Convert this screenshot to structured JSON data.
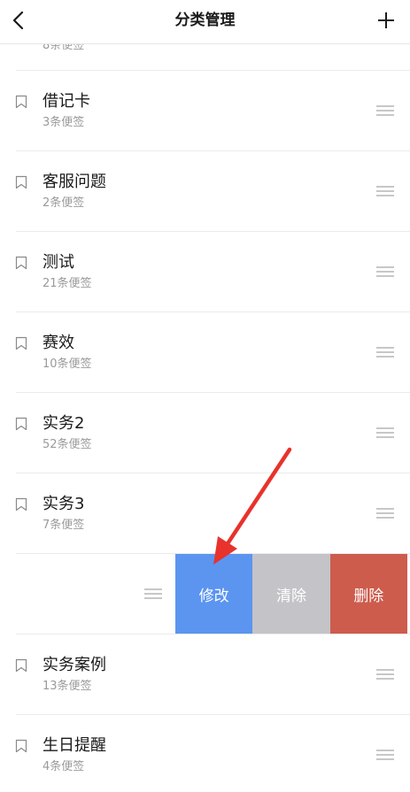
{
  "header": {
    "title": "分类管理",
    "back_icon": "chevron-left-icon",
    "add_icon": "plus-icon"
  },
  "peek_item": {
    "count": "8条便签"
  },
  "items": [
    {
      "name": "借记卡",
      "count": "3条便签"
    },
    {
      "name": "客服问题",
      "count": "2条便签"
    },
    {
      "name": "测试",
      "count": "21条便签"
    },
    {
      "name": "赛效",
      "count": "10条便签"
    },
    {
      "name": "实务2",
      "count": "52条便签"
    },
    {
      "name": "实务3",
      "count": "7条便签"
    }
  ],
  "swipe_actions": {
    "edit_label": "修改",
    "clear_label": "清除",
    "delete_label": "删除"
  },
  "items_after": [
    {
      "name": "实务案例",
      "count": "13条便签"
    },
    {
      "name": "生日提醒",
      "count": "4条便签"
    }
  ],
  "colors": {
    "edit": "#5b95f0",
    "clear": "#c4c4c8",
    "delete": "#cd5c4d",
    "annotation_arrow": "#e8322c"
  }
}
